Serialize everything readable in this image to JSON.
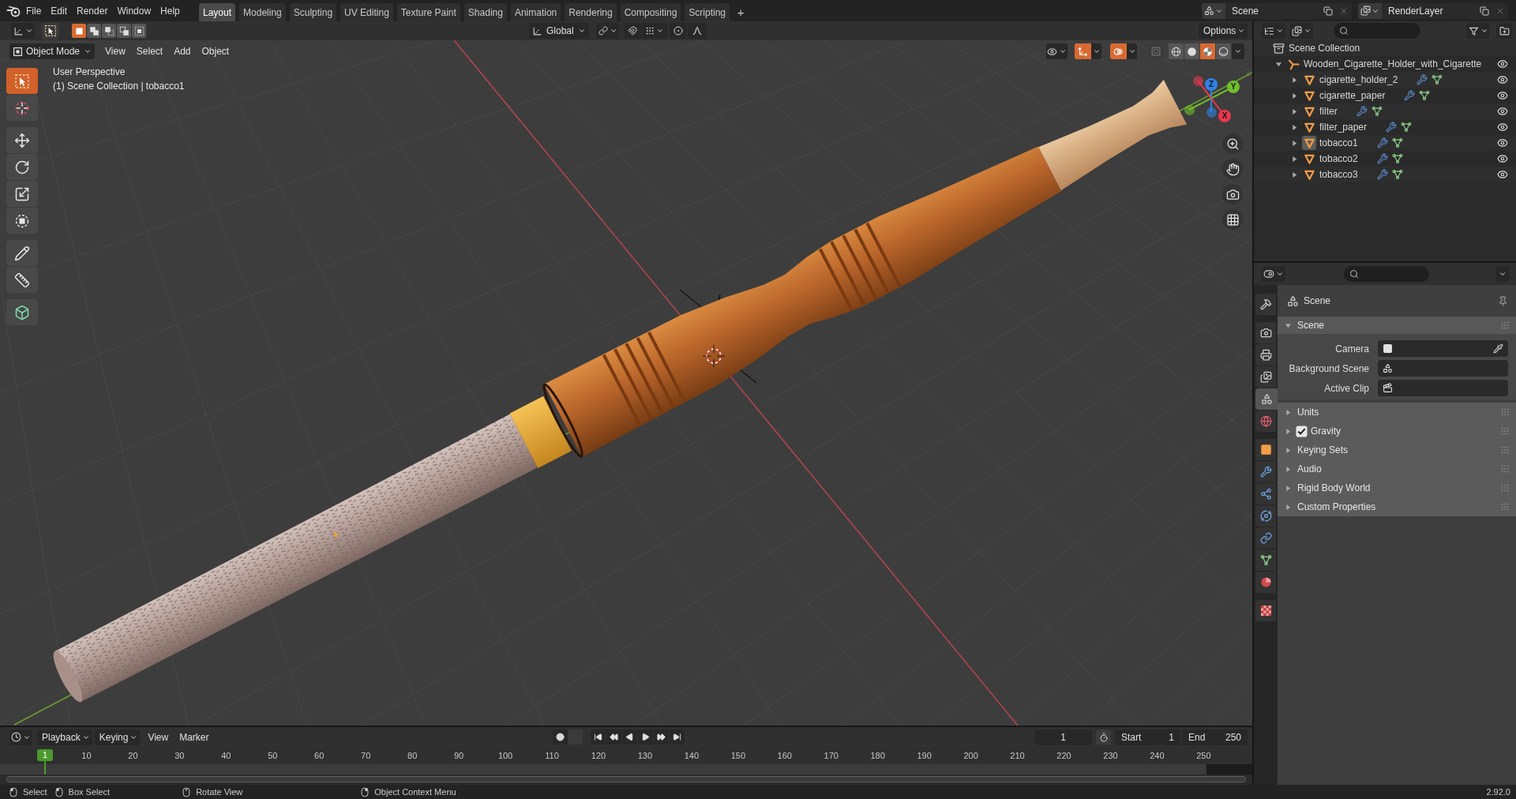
{
  "top_bar": {
    "menus": [
      "File",
      "Edit",
      "Render",
      "Window",
      "Help"
    ],
    "workspaces": [
      {
        "label": "Layout",
        "selected": true
      },
      {
        "label": "Modeling",
        "selected": false
      },
      {
        "label": "Sculpting",
        "selected": false
      },
      {
        "label": "UV Editing",
        "selected": false
      },
      {
        "label": "Texture Paint",
        "selected": false
      },
      {
        "label": "Shading",
        "selected": false
      },
      {
        "label": "Animation",
        "selected": false
      },
      {
        "label": "Rendering",
        "selected": false
      },
      {
        "label": "Compositing",
        "selected": false
      },
      {
        "label": "Scripting",
        "selected": false
      }
    ],
    "add_workspace": "+",
    "scene": "Scene",
    "view_layer": "RenderLayer"
  },
  "tool_settings": {
    "selection_modes": [
      {
        "kind": "set",
        "selected": true
      },
      {
        "kind": "extend",
        "selected": false
      },
      {
        "kind": "subtract",
        "selected": false
      },
      {
        "kind": "invert",
        "selected": false
      },
      {
        "kind": "intersect",
        "selected": false
      }
    ],
    "orientation": "Global",
    "options": "Options"
  },
  "viewport": {
    "mode": "Object Mode",
    "menus": [
      "View",
      "Select",
      "Add",
      "Object"
    ],
    "show_gizmos": true,
    "show_overlays": true,
    "xray": false,
    "shading": [
      {
        "kind": "wireframe",
        "selected": false
      },
      {
        "kind": "solid",
        "selected": false
      },
      {
        "kind": "material",
        "selected": true
      },
      {
        "kind": "rendered",
        "selected": false
      }
    ],
    "view_name": "User Perspective",
    "view_context": "(1) Scene Collection | tobacco1",
    "tool_groups": [
      [
        {
          "kind": "select_box",
          "selected": true
        },
        {
          "kind": "cursor",
          "selected": false
        }
      ],
      [
        {
          "kind": "move",
          "selected": false
        },
        {
          "kind": "rotate",
          "selected": false
        },
        {
          "kind": "scale",
          "selected": false
        },
        {
          "kind": "transform",
          "selected": false
        }
      ],
      [
        {
          "kind": "annotate",
          "selected": false
        },
        {
          "kind": "measure",
          "selected": false
        }
      ],
      [
        {
          "kind": "add_cube",
          "selected": false
        }
      ]
    ],
    "axes": [
      {
        "label": "Z",
        "color": "#2f83e6"
      },
      {
        "label": "Y",
        "color": "#6fbf2a"
      },
      {
        "label": "X",
        "color": "#e8384f"
      }
    ]
  },
  "outliner": {
    "root": "Scene Collection",
    "items": [
      {
        "name": "Wooden_Cigarette_Holder_with_Cigarette",
        "kind": "empty",
        "expanded": true,
        "active": false,
        "visible": true,
        "children": [
          {
            "name": "cigarette_holder_2",
            "kind": "mesh",
            "expanded": false,
            "active": false,
            "visible": true,
            "modifiers": true,
            "mesh_data": true
          },
          {
            "name": "cigarette_paper",
            "kind": "mesh",
            "expanded": false,
            "active": false,
            "visible": true,
            "modifiers": true,
            "mesh_data": true
          },
          {
            "name": "filter",
            "kind": "mesh",
            "expanded": false,
            "active": false,
            "visible": true,
            "modifiers": true,
            "mesh_data": true
          },
          {
            "name": "filter_paper",
            "kind": "mesh",
            "expanded": false,
            "active": false,
            "visible": true,
            "modifiers": true,
            "mesh_data": true
          },
          {
            "name": "tobacco1",
            "kind": "mesh",
            "expanded": false,
            "active": true,
            "visible": true,
            "modifiers": true,
            "mesh_data": true
          },
          {
            "name": "tobacco2",
            "kind": "mesh",
            "expanded": false,
            "active": false,
            "visible": true,
            "modifiers": true,
            "mesh_data": true
          },
          {
            "name": "tobacco3",
            "kind": "mesh",
            "expanded": false,
            "active": false,
            "visible": true,
            "modifiers": true,
            "mesh_data": true
          }
        ]
      }
    ]
  },
  "properties": {
    "tab_groups": [
      [
        {
          "kind": "tool",
          "selected": false
        }
      ],
      [
        {
          "kind": "render",
          "selected": false
        },
        {
          "kind": "output",
          "selected": false
        },
        {
          "kind": "view_layer",
          "selected": false
        },
        {
          "kind": "scene",
          "selected": true
        },
        {
          "kind": "world",
          "selected": false
        }
      ],
      [
        {
          "kind": "object",
          "selected": false
        },
        {
          "kind": "modifiers",
          "selected": false
        },
        {
          "kind": "particles",
          "selected": false
        },
        {
          "kind": "physics",
          "selected": false
        },
        {
          "kind": "constraints",
          "selected": false
        },
        {
          "kind": "data",
          "selected": false
        },
        {
          "kind": "material",
          "selected": false
        }
      ],
      [
        {
          "kind": "texture",
          "selected": false
        }
      ]
    ],
    "context": "Scene",
    "panels": [
      {
        "title": "Scene",
        "expanded": true,
        "fields": [
          {
            "label": "Camera",
            "kind": "object"
          },
          {
            "label": "Background Scene",
            "kind": "scene"
          },
          {
            "label": "Active Clip",
            "kind": "clip"
          }
        ]
      },
      {
        "title": "Units",
        "expanded": false
      },
      {
        "title": "Gravity",
        "expanded": false,
        "checkbox": {
          "checked": true
        }
      },
      {
        "title": "Keying Sets",
        "expanded": false
      },
      {
        "title": "Audio",
        "expanded": false
      },
      {
        "title": "Rigid Body World",
        "expanded": false
      },
      {
        "title": "Custom Properties",
        "expanded": false
      }
    ]
  },
  "timeline": {
    "dropdowns": [
      "Playback",
      "Keying"
    ],
    "menus": [
      "View",
      "Marker"
    ],
    "current_frame": "1",
    "start": {
      "label": "Start",
      "value": "1"
    },
    "end": {
      "label": "End",
      "value": "250"
    },
    "ruler": {
      "current": "1",
      "labels": [
        "10",
        "20",
        "30",
        "40",
        "50",
        "60",
        "70",
        "80",
        "90",
        "100",
        "110",
        "120",
        "130",
        "140",
        "150",
        "160",
        "170",
        "180",
        "190",
        "200",
        "210",
        "220",
        "230",
        "240",
        "250"
      ]
    }
  },
  "status_bar": {
    "hints": [
      {
        "kind": "left",
        "label": "Select"
      },
      {
        "kind": "drag",
        "label": "Box Select"
      },
      {
        "kind": "middle",
        "label": "Rotate View"
      },
      {
        "kind": "right",
        "label": "Object Context Menu"
      }
    ],
    "version": "2.92.0"
  }
}
